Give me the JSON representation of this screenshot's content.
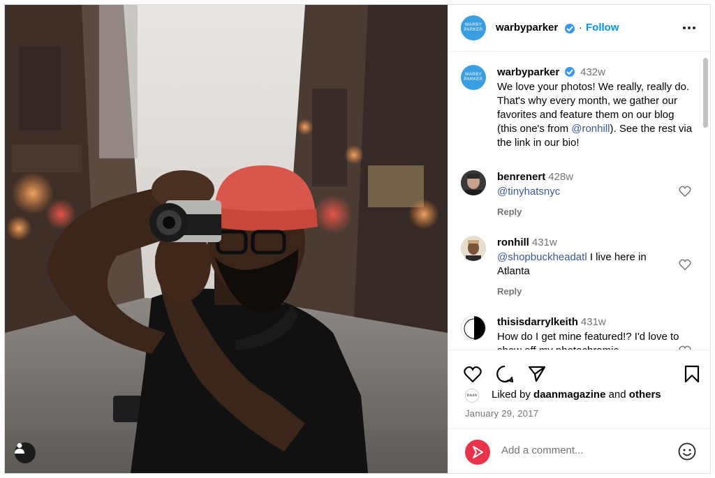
{
  "post": {
    "author": "warbyparker",
    "avatar_text": [
      "WARBY",
      "PARKER"
    ],
    "follow_label": "Follow",
    "separator": "·",
    "verified": true
  },
  "caption": {
    "username": "warbyparker",
    "time": "432w",
    "text_before": "We love your photos! We really, really do. That's why every month, we gather our favorites and feature them on our blog (this one's from ",
    "mention": "@ronhill",
    "text_after": "). See the rest via the link in our bio!"
  },
  "comments": [
    {
      "username": "benrenert",
      "time": "428w",
      "mention": "@tinyhatsnyc",
      "text": "",
      "reply_label": "Reply"
    },
    {
      "username": "ronhill",
      "time": "431w",
      "mention": "@shopbuckheadatl",
      "text": " I live here in Atlanta",
      "reply_label": "Reply"
    },
    {
      "username": "thisisdarrylkeith",
      "time": "431w",
      "mention": "",
      "text": "How do I get mine featured!? I'd love to show off my photochromic",
      "reply_label": ""
    }
  ],
  "likes": {
    "prefix": "Liked by",
    "user": "daanmagazine",
    "joiner": "and",
    "others": "others",
    "avatar_text": "DAAN"
  },
  "date": "January 29, 2017",
  "composer": {
    "placeholder": "Add a comment..."
  },
  "icons": {
    "header_more": "more-horizontal-icon",
    "like": "heart-icon",
    "comment": "comment-bubble-icon",
    "share": "paper-plane-icon",
    "save": "bookmark-icon",
    "emoji": "smiley-icon",
    "tag": "user-tag-icon"
  },
  "colors": {
    "accent": "#0095f6",
    "mention": "#385898",
    "brand_avatar": "#3b9ee0",
    "verified": "#3897f0",
    "hat": "#d9574a"
  }
}
